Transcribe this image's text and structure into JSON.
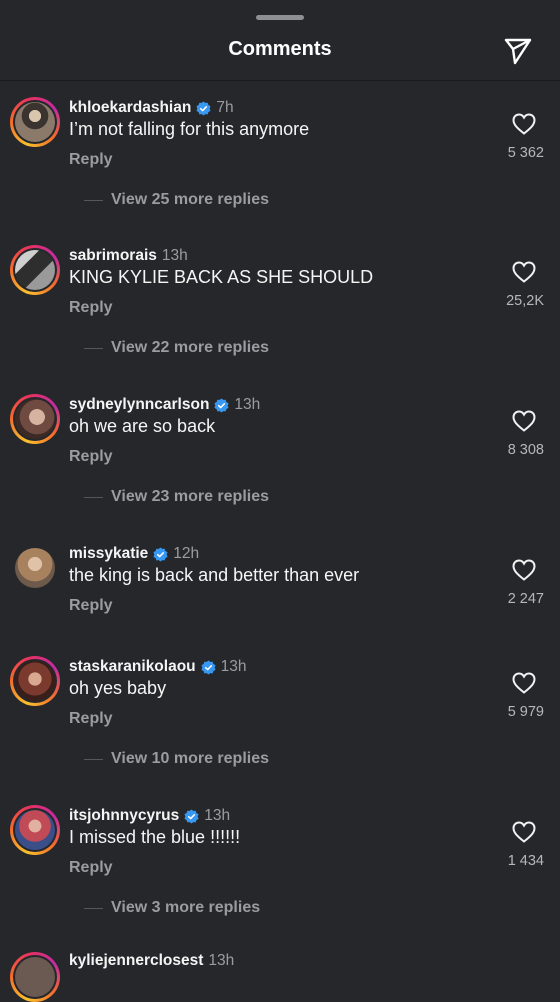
{
  "header": {
    "title": "Comments"
  },
  "comments": [
    {
      "username": "khloekardashian",
      "verified": true,
      "time": "7h",
      "text": "I’m not falling for this anymore",
      "reply_label": "Reply",
      "likes": "5 362",
      "view_more": "View 25 more replies",
      "avatar_color": "#7a6a5c"
    },
    {
      "username": "sabrimorais",
      "verified": false,
      "time": "13h",
      "text": "KING KYLIE BACK AS SHE SHOULD",
      "reply_label": "Reply",
      "likes": "25,2K",
      "view_more": "View 22 more replies",
      "avatar_color": "#5a5a5a"
    },
    {
      "username": "sydneylynncarlson",
      "verified": true,
      "time": "13h",
      "text": "oh we are so back",
      "reply_label": "Reply",
      "likes": "8 308",
      "view_more": "View 23 more replies",
      "avatar_color": "#a57c6e"
    },
    {
      "username": "missykatie",
      "verified": true,
      "time": "12h",
      "text": "the king is back and better than ever",
      "reply_label": "Reply",
      "likes": "2 247",
      "view_more": "",
      "avatar_color": "#b69378"
    },
    {
      "username": "staskaranikolaou",
      "verified": true,
      "time": "13h",
      "text": "oh yes baby",
      "reply_label": "Reply",
      "likes": "5 979",
      "view_more": "View 10 more replies",
      "avatar_color": "#8a4a3c"
    },
    {
      "username": "itsjohnnycyrus",
      "verified": true,
      "time": "13h",
      "text": "I missed the blue !!!!!!",
      "reply_label": "Reply",
      "likes": "1 434",
      "view_more": "View 3 more replies",
      "avatar_color": "#b04850"
    }
  ],
  "partial_comment": {
    "username": "kyliejennerclosest",
    "time": "13h"
  },
  "icons": {
    "send": "paper-plane-icon",
    "like": "heart-icon",
    "verified": "verified-badge-icon"
  },
  "colors": {
    "background": "#25272b",
    "verified_blue": "#3897f0",
    "muted_text": "#9a9ca1"
  }
}
